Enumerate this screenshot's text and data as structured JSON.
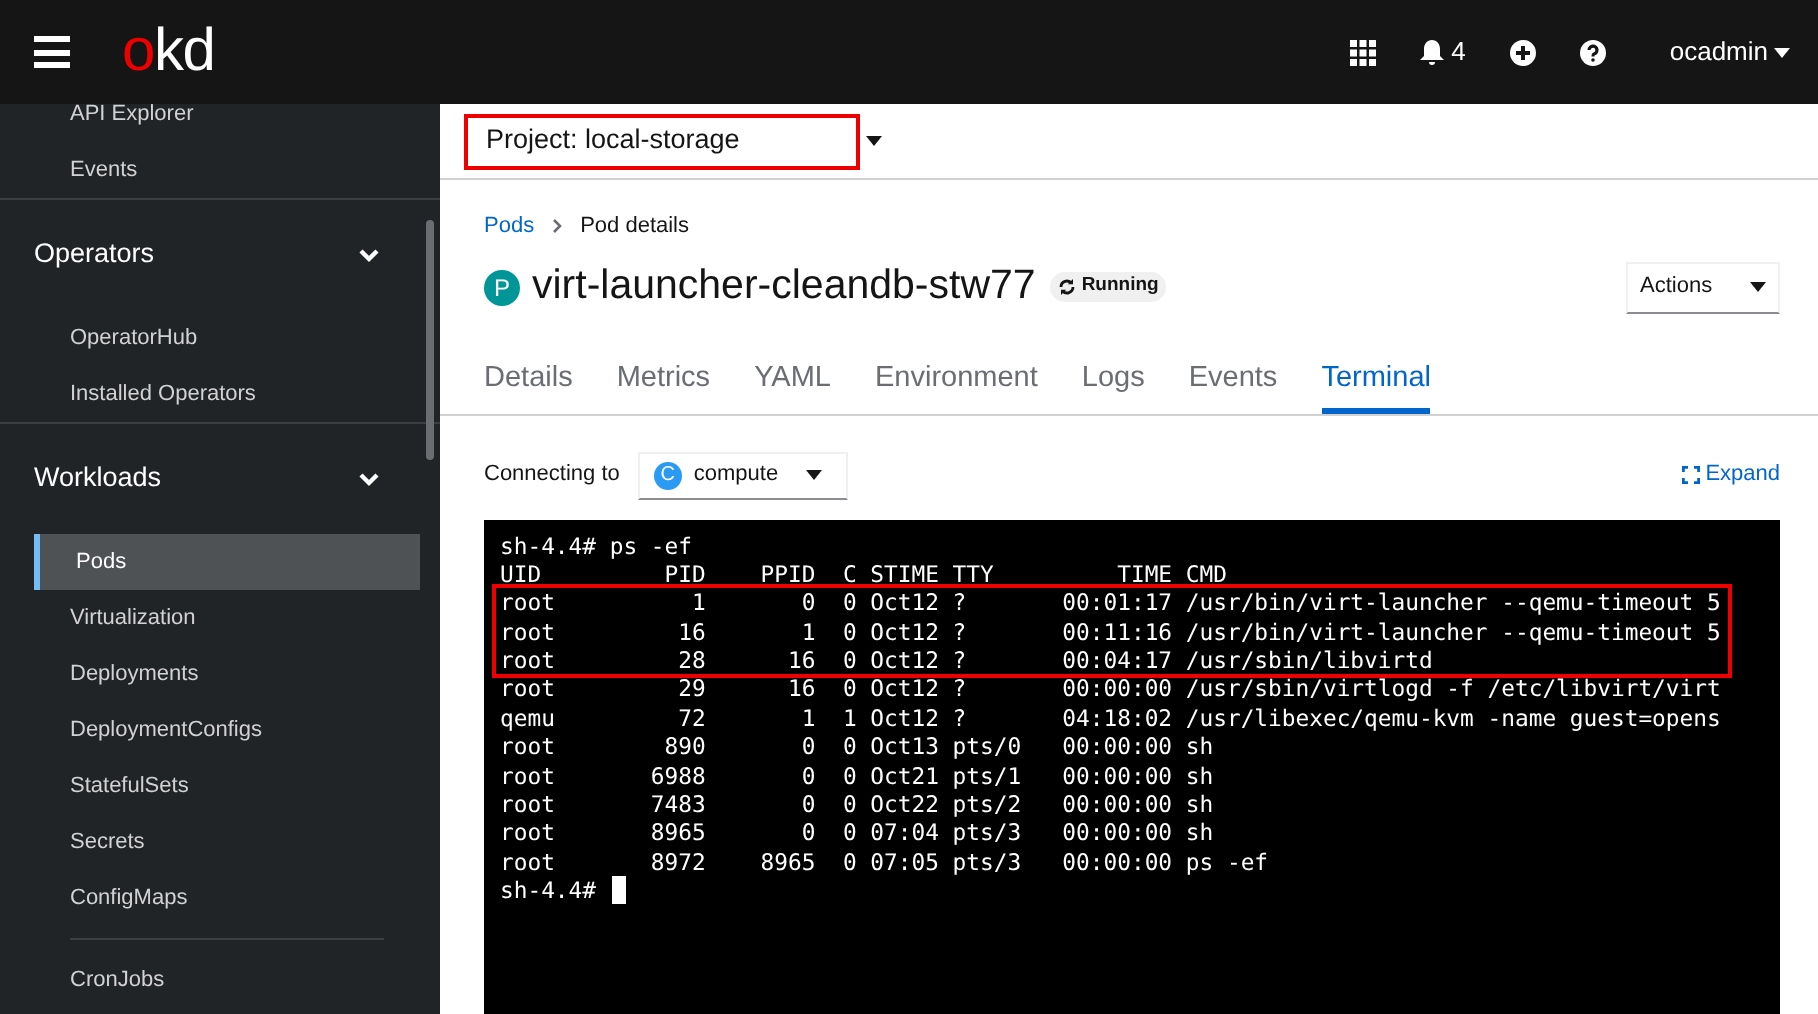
{
  "masthead": {
    "logo": "okd",
    "notifications": "4",
    "user": "ocadmin"
  },
  "sidebar": {
    "items": [
      {
        "kind": "link",
        "label": "API Explorer",
        "selected": false
      },
      {
        "kind": "link",
        "label": "Events",
        "selected": false
      },
      {
        "kind": "section",
        "label": "Operators",
        "expanded": true
      },
      {
        "kind": "link",
        "label": "OperatorHub",
        "selected": false
      },
      {
        "kind": "link",
        "label": "Installed Operators",
        "selected": false
      },
      {
        "kind": "section",
        "label": "Workloads",
        "expanded": true
      },
      {
        "kind": "link",
        "label": "Pods",
        "selected": true
      },
      {
        "kind": "link",
        "label": "Virtualization",
        "selected": false
      },
      {
        "kind": "link",
        "label": "Deployments",
        "selected": false
      },
      {
        "kind": "link",
        "label": "DeploymentConfigs",
        "selected": false
      },
      {
        "kind": "link",
        "label": "StatefulSets",
        "selected": false
      },
      {
        "kind": "link",
        "label": "Secrets",
        "selected": false
      },
      {
        "kind": "link",
        "label": "ConfigMaps",
        "selected": false
      },
      {
        "kind": "divider"
      },
      {
        "kind": "link",
        "label": "CronJobs",
        "selected": false
      }
    ]
  },
  "project_selector": {
    "label": "Project: local-storage",
    "highlighted": true
  },
  "breadcrumb": [
    "Pods",
    "Pod details"
  ],
  "title": {
    "badge": "P",
    "name": "virt-launcher-cleandb-stw77",
    "status": "Running"
  },
  "actions_button": "Actions",
  "tabs": [
    {
      "label": "Details",
      "selected": false
    },
    {
      "label": "Metrics",
      "selected": false
    },
    {
      "label": "YAML",
      "selected": false
    },
    {
      "label": "Environment",
      "selected": false
    },
    {
      "label": "Logs",
      "selected": false
    },
    {
      "label": "Events",
      "selected": false
    },
    {
      "label": "Terminal",
      "selected": true
    }
  ],
  "connection": {
    "label": "Connecting to",
    "container_badge": "C",
    "container": "compute",
    "expand": "Expand"
  },
  "terminal": {
    "lines": [
      {
        "text": "sh-4.4# ps -ef",
        "highlighted": false
      },
      {
        "text": "UID         PID    PPID  C STIME TTY         TIME CMD",
        "highlighted": false
      },
      {
        "text": "root          1       0  0 Oct12 ?       00:01:17 /usr/bin/virt-launcher --qemu-timeout 5",
        "highlighted": true
      },
      {
        "text": "root         16       1  0 Oct12 ?       00:11:16 /usr/bin/virt-launcher --qemu-timeout 5",
        "highlighted": true
      },
      {
        "text": "root         28      16  0 Oct12 ?       00:04:17 /usr/sbin/libvirtd",
        "highlighted": true
      },
      {
        "text": "root         29      16  0 Oct12 ?       00:00:00 /usr/sbin/virtlogd -f /etc/libvirt/virt",
        "highlighted": false
      },
      {
        "text": "qemu         72       1  1 Oct12 ?       04:18:02 /usr/libexec/qemu-kvm -name guest=opens",
        "highlighted": false
      },
      {
        "text": "root        890       0  0 Oct13 pts/0   00:00:00 sh",
        "highlighted": false
      },
      {
        "text": "root       6988       0  0 Oct21 pts/1   00:00:00 sh",
        "highlighted": false
      },
      {
        "text": "root       7483       0  0 Oct22 pts/2   00:00:00 sh",
        "highlighted": false
      },
      {
        "text": "root       8965       0  0 07:04 pts/3   00:00:00 sh",
        "highlighted": false
      },
      {
        "text": "root       8972    8965  0 07:05 pts/3   00:00:00 ps -ef",
        "highlighted": false
      }
    ],
    "prompt": "sh-4.4#"
  }
}
